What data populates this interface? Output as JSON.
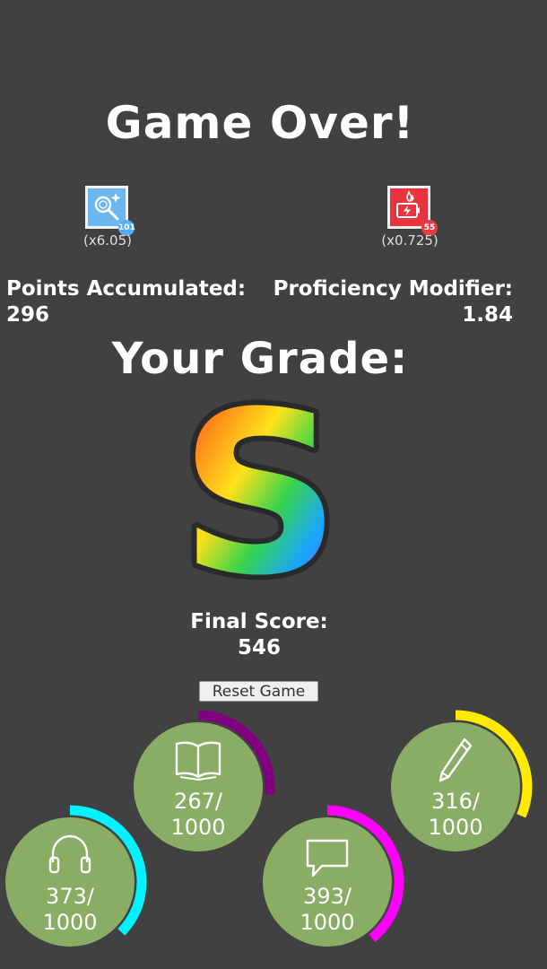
{
  "title": "Game Over!",
  "powerups": [
    {
      "name": "search-powerup",
      "icon": "magnifier-sparkle-icon",
      "badge": "101",
      "badge_color": "#5aaef0",
      "tile_color": "#6cb7f0",
      "multiplier": "(x6.05)"
    },
    {
      "name": "battery-powerup",
      "icon": "battery-flame-icon",
      "badge": "55",
      "badge_color": "#e63b45",
      "tile_color": "#e8343e",
      "multiplier": "(x0.725)"
    }
  ],
  "points": {
    "label": "Points Accumulated:",
    "value": "296"
  },
  "proficiency": {
    "label": "Proficiency Modifier:",
    "value": "1.84"
  },
  "grade": {
    "heading": "Your Grade:",
    "letter": "S"
  },
  "final_score": {
    "label": "Final Score:",
    "value": "546"
  },
  "reset_label": "Reset Game",
  "skills": [
    {
      "name": "reading",
      "icon": "book-icon",
      "value_line1": "267/",
      "value_line2": "1000",
      "progress": 0.267,
      "ring_color": "#800080"
    },
    {
      "name": "writing",
      "icon": "pencil-icon",
      "value_line1": "316/",
      "value_line2": "1000",
      "progress": 0.316,
      "ring_color": "#ffea00"
    },
    {
      "name": "listening",
      "icon": "headphones-icon",
      "value_line1": "373/",
      "value_line2": "1000",
      "progress": 0.373,
      "ring_color": "#00f4ff"
    },
    {
      "name": "speaking",
      "icon": "speech-bubble-icon",
      "value_line1": "393/",
      "value_line2": "1000",
      "progress": 0.393,
      "ring_color": "#ff00ff"
    }
  ],
  "colors": {
    "background": "#414141",
    "skill_circle": "#8aad66"
  }
}
